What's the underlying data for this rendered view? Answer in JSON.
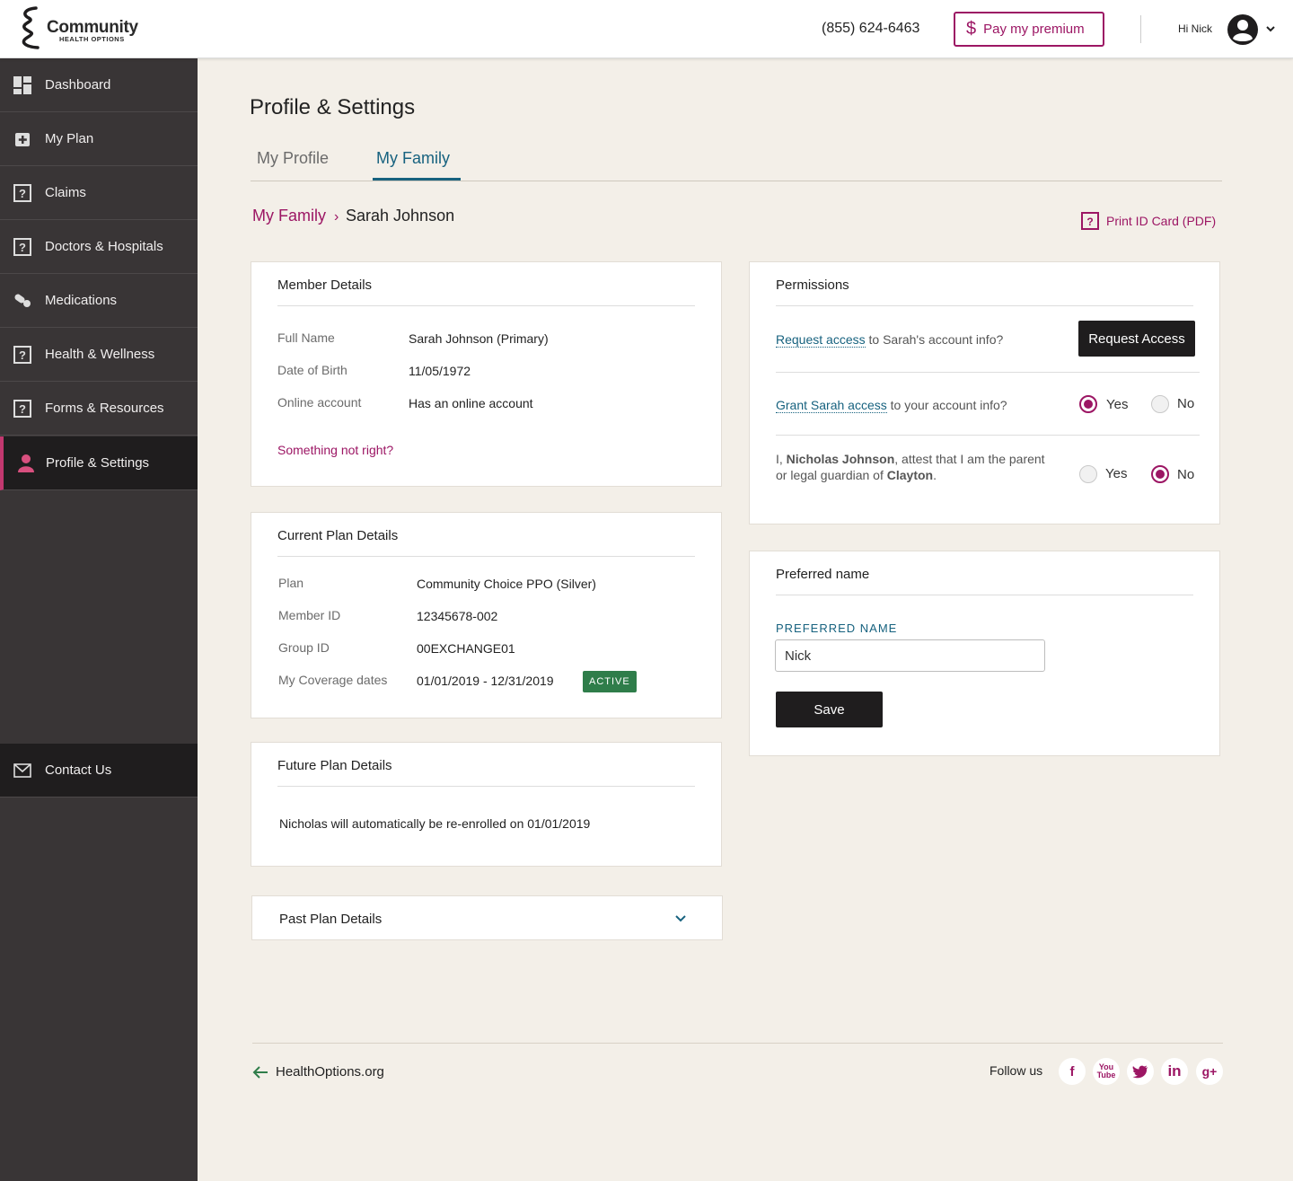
{
  "header": {
    "logo_line1": "Community",
    "logo_line2": "HEALTH OPTIONS",
    "phone": "(855) 624-6463",
    "pay_label": "Pay my premium",
    "greeting": "Hi Nick"
  },
  "sidebar": {
    "items": [
      {
        "label": "Dashboard",
        "icon": "dashboard-icon"
      },
      {
        "label": "My Plan",
        "icon": "medical-plus-icon"
      },
      {
        "label": "Claims",
        "icon": "question-box-icon"
      },
      {
        "label": "Doctors & Hospitals",
        "icon": "question-box-icon"
      },
      {
        "label": "Medications",
        "icon": "pills-icon"
      },
      {
        "label": "Health & Wellness",
        "icon": "question-box-icon"
      },
      {
        "label": "Forms & Resources",
        "icon": "question-box-icon"
      },
      {
        "label": "Profile & Settings",
        "icon": "person-icon"
      }
    ],
    "contact": {
      "label": "Contact Us",
      "icon": "envelope-icon"
    }
  },
  "page": {
    "title": "Profile & Settings",
    "tabs": [
      "My Profile",
      "My Family"
    ],
    "active_tab": "My Family",
    "breadcrumb_parent": "My Family",
    "breadcrumb_current": "Sarah Johnson",
    "print_label": "Print ID Card (PDF)"
  },
  "member_details": {
    "title": "Member Details",
    "rows": [
      {
        "label": "Full Name",
        "value": "Sarah Johnson (Primary)"
      },
      {
        "label": "Date of Birth",
        "value": "11/05/1972"
      },
      {
        "label": "Online account",
        "value": "Has an online account"
      }
    ],
    "help_link": "Something not right?"
  },
  "current_plan": {
    "title": "Current Plan Details",
    "rows": [
      {
        "label": "Plan",
        "value": "Community Choice PPO (Silver)"
      },
      {
        "label": "Member ID",
        "value": "12345678-002"
      },
      {
        "label": "Group ID",
        "value": "00EXCHANGE01"
      },
      {
        "label": "My Coverage dates",
        "value": "01/01/2019 - 12/31/2019"
      }
    ],
    "status_badge": "ACTIVE"
  },
  "future_plan": {
    "title": "Future Plan Details",
    "text": "Nicholas will automatically be re-enrolled on 01/01/2019"
  },
  "past_plan": {
    "title": "Past Plan Details"
  },
  "permissions": {
    "title": "Permissions",
    "request": {
      "link": "Request access",
      "text": " to Sarah's account info?",
      "button": "Request Access"
    },
    "grant": {
      "link": "Grant Sarah access",
      "text": " to your account info?",
      "yes": "Yes",
      "no": "No",
      "selected": "Yes"
    },
    "attest": {
      "prefix": "I, ",
      "name": "Nicholas Johnson",
      "middle": ", attest that I am the parent or legal guardian of ",
      "child": "Clayton",
      "suffix": ".",
      "yes": "Yes",
      "no": "No",
      "selected": "No"
    }
  },
  "preferred_name": {
    "title": "Preferred name",
    "field_label": "PREFERRED NAME",
    "value": "Nick",
    "save": "Save"
  },
  "footer": {
    "link": "HealthOptions.org",
    "follow": "Follow us",
    "social": [
      "facebook-icon",
      "youtube-icon",
      "twitter-icon",
      "linkedin-icon",
      "google-plus-icon"
    ]
  },
  "colors": {
    "brand": "#9c1664",
    "teal": "#17627f",
    "sidebar": "#393536",
    "active_badge": "#2f7d4a",
    "background": "#f3efe8"
  }
}
